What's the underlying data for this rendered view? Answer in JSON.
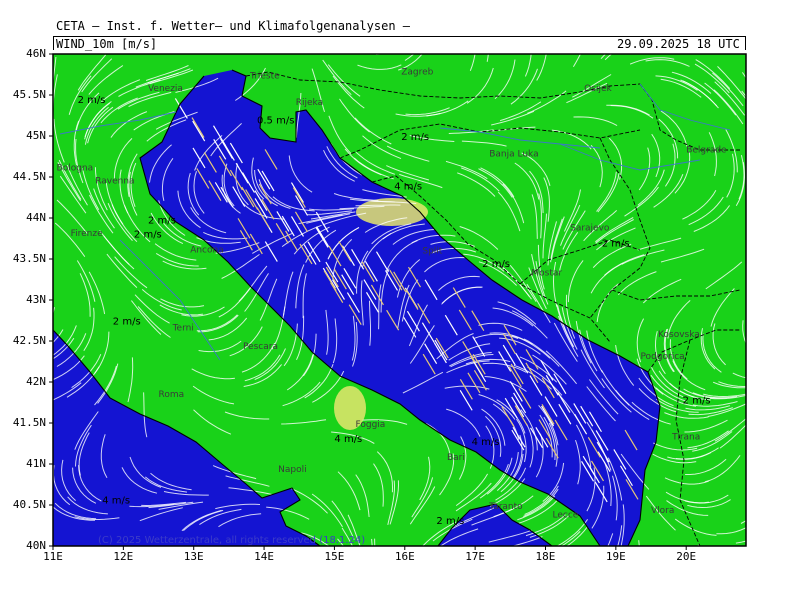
{
  "header": {
    "title": "CETA — Inst. f. Wetter— und Klimafolgenanalysen —",
    "parameter": "WIND_10m [m/s]",
    "valid_time": "29.09.2025 18 UTC"
  },
  "axes": {
    "lat_labels": [
      "46N",
      "45.5N",
      "45N",
      "44.5N",
      "44N",
      "43.5N",
      "43N",
      "42.5N",
      "42N",
      "41.5N",
      "41N",
      "40.5N",
      "40N"
    ],
    "lon_labels": [
      "11E",
      "12E",
      "13E",
      "14E",
      "15E",
      "16E",
      "17E",
      "18E",
      "19E",
      "20E"
    ]
  },
  "colors": {
    "land_low_wind": "#19d219",
    "sea_wind": "#1414d2",
    "strong_wind": "#e6e66e",
    "streamline": "#ffffff",
    "border": "#000000",
    "river": "#3c78c8"
  },
  "cities": [
    {
      "name": "Venezia",
      "lon": 12.35,
      "lat": 45.55
    },
    {
      "name": "Trieste",
      "lon": 13.8,
      "lat": 45.7
    },
    {
      "name": "Zagreb",
      "lon": 15.95,
      "lat": 45.75
    },
    {
      "name": "Osijek",
      "lon": 18.55,
      "lat": 45.55
    },
    {
      "name": "Rijeka",
      "lon": 14.45,
      "lat": 45.38
    },
    {
      "name": "Bologna",
      "lon": 11.05,
      "lat": 44.58
    },
    {
      "name": "Ravenna",
      "lon": 11.6,
      "lat": 44.42
    },
    {
      "name": "Banja Luka",
      "lon": 17.2,
      "lat": 44.75
    },
    {
      "name": "Belgrade",
      "lon": 20.0,
      "lat": 44.8
    },
    {
      "name": "Firenze",
      "lon": 11.25,
      "lat": 43.78
    },
    {
      "name": "Split",
      "lon": 16.25,
      "lat": 43.57
    },
    {
      "name": "Sarajevo",
      "lon": 18.35,
      "lat": 43.85
    },
    {
      "name": "Ancona",
      "lon": 12.95,
      "lat": 43.58
    },
    {
      "name": "Mostar",
      "lon": 17.8,
      "lat": 43.3
    },
    {
      "name": "Terni",
      "lon": 12.7,
      "lat": 42.63
    },
    {
      "name": "Pescara",
      "lon": 13.7,
      "lat": 42.4
    },
    {
      "name": "Kosovska",
      "lon": 19.6,
      "lat": 42.55
    },
    {
      "name": "Podgorica",
      "lon": 19.35,
      "lat": 42.28
    },
    {
      "name": "Roma",
      "lon": 12.5,
      "lat": 41.82
    },
    {
      "name": "Foggia",
      "lon": 15.3,
      "lat": 41.45
    },
    {
      "name": "Bari",
      "lon": 16.6,
      "lat": 41.05
    },
    {
      "name": "Tirana",
      "lon": 19.8,
      "lat": 41.3
    },
    {
      "name": "Napoli",
      "lon": 14.2,
      "lat": 40.9
    },
    {
      "name": "Taranto",
      "lon": 17.2,
      "lat": 40.45
    },
    {
      "name": "Lecce",
      "lon": 18.1,
      "lat": 40.35
    },
    {
      "name": "Vlora",
      "lon": 19.5,
      "lat": 40.4
    }
  ],
  "speed_labels": [
    {
      "text": "2 m/s",
      "lon": 11.35,
      "lat": 45.4
    },
    {
      "text": "0.5 m/s",
      "lon": 13.9,
      "lat": 45.15
    },
    {
      "text": "2 m/s",
      "lon": 15.95,
      "lat": 44.95
    },
    {
      "text": "4 m/s",
      "lon": 15.85,
      "lat": 44.35
    },
    {
      "text": "2 m/s",
      "lon": 12.35,
      "lat": 43.93
    },
    {
      "text": "2 m/s",
      "lon": 12.15,
      "lat": 43.76
    },
    {
      "text": "2 m/s",
      "lon": 18.8,
      "lat": 43.65
    },
    {
      "text": "2 m/s",
      "lon": 17.1,
      "lat": 43.4
    },
    {
      "text": "2 m/s",
      "lon": 11.85,
      "lat": 42.7
    },
    {
      "text": "2 m/s",
      "lon": 19.95,
      "lat": 41.74
    },
    {
      "text": "4 m/s",
      "lon": 15.0,
      "lat": 41.27
    },
    {
      "text": "4 m/s",
      "lon": 16.95,
      "lat": 41.23
    },
    {
      "text": "4 m/s",
      "lon": 11.7,
      "lat": 40.52
    },
    {
      "text": "2 m/s",
      "lon": 16.45,
      "lat": 40.27
    }
  ],
  "copyright": "(C) 2025 Wetterzentrale, all rights reserved (18.1.24)"
}
